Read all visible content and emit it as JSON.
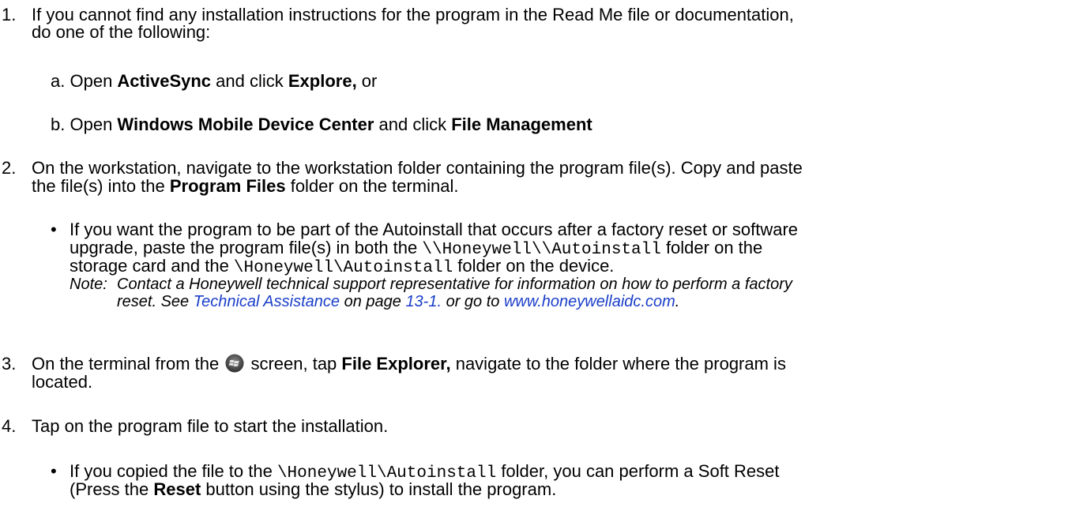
{
  "steps": [
    {
      "number": "1.",
      "line1": "If you cannot find any installation instructions for the program in the Read Me file or documentation,",
      "line2": "do one of the following:",
      "substeps": [
        {
          "letter": "a.",
          "pre": "Open ",
          "bold1": "ActiveSync",
          "mid": " and click ",
          "bold2": "Explore,",
          "post": " or"
        },
        {
          "letter": "b.",
          "pre": "Open ",
          "bold1": "Windows Mobile Device Center",
          "mid": " and click ",
          "bold2": "File Management",
          "post": ""
        }
      ]
    },
    {
      "number": "2.",
      "line1": "On the workstation, navigate to the workstation folder containing the program file(s). Copy and paste",
      "line2_pre": "the file(s) into the ",
      "line2_bold": "Program Files",
      "line2_post": " folder on the terminal.",
      "bullet": {
        "symbol": "•",
        "line1": "If you want the program to be part of the Autoinstall that occurs after a factory reset or software",
        "line2_pre": "upgrade, paste the program file(s) in both the ",
        "line2_code": "\\\\Honeywell\\\\Autoinstall",
        "line2_post": " folder on the",
        "line3_pre": "storage card and the ",
        "line3_code": "\\Honeywell\\Autoinstall",
        "line3_post": " folder on the device."
      },
      "note": {
        "label": "Note:",
        "line1": "Contact a Honeywell technical support representative for information on how to perform a factory",
        "line2_pre": "reset. See ",
        "link1": "Technical Assistance",
        "line2_mid": " on page ",
        "link2": "13-1.",
        "line2_mid2": " or go to ",
        "link3": "www.honeywellaidc.com",
        "line2_post": "."
      }
    },
    {
      "number": "3.",
      "line1_pre": "On the terminal from the",
      "line1_icon": "windows-start-icon",
      "line1_mid": " screen, tap ",
      "line1_bold": "File Explorer,",
      "line1_post": " navigate to the folder where the program is",
      "line2": "located."
    },
    {
      "number": "4.",
      "line1": "Tap on the program file to start the installation.",
      "bullet": {
        "symbol": "•",
        "line1_pre": "If you copied the file to the ",
        "line1_code": "\\Honeywell\\Autoinstall",
        "line1_post": " folder, you can perform a Soft Reset",
        "line2_pre": "(Press the ",
        "line2_bold": "Reset",
        "line2_post": " button using the stylus) to install the program."
      }
    }
  ],
  "colors": {
    "link": "#1a3ec9",
    "text": "#000000"
  }
}
